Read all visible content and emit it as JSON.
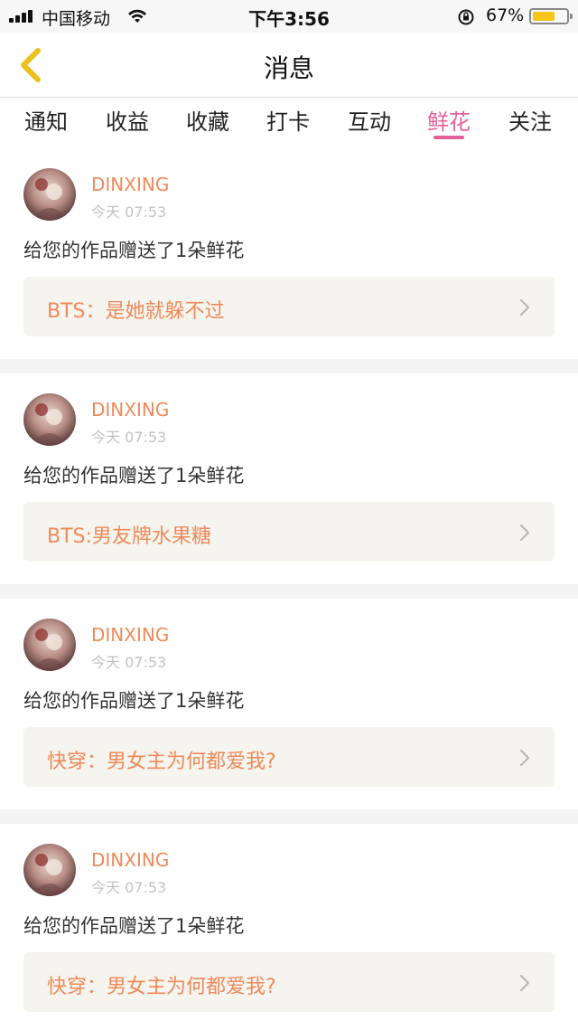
{
  "status_bar": {
    "carrier": "中国移动",
    "time": "下午3:56",
    "battery_percent": "67%",
    "battery_level": 0.67,
    "battery_color": "#f5c518"
  },
  "nav": {
    "title": "消息",
    "back_icon": "chevron-left-icon",
    "back_color": "#e8c21a"
  },
  "tabs": [
    {
      "label": "通知",
      "active": false
    },
    {
      "label": "收益",
      "active": false
    },
    {
      "label": "收藏",
      "active": false
    },
    {
      "label": "打卡",
      "active": false
    },
    {
      "label": "互动",
      "active": false
    },
    {
      "label": "鲜花",
      "active": true
    },
    {
      "label": "关注",
      "active": false
    }
  ],
  "accent_color": "#e2609b",
  "notifications": [
    {
      "user": "DINXING",
      "time": "今天 07:53",
      "message": "给您的作品赠送了1朵鲜花",
      "work": "BTS：是她就躲不过"
    },
    {
      "user": "DINXING",
      "time": "今天 07:53",
      "message": "给您的作品赠送了1朵鲜花",
      "work": "BTS:男友牌水果糖"
    },
    {
      "user": "DINXING",
      "time": "今天 07:53",
      "message": "给您的作品赠送了1朵鲜花",
      "work": "快穿：男女主为何都爱我?"
    },
    {
      "user": "DINXING",
      "time": "今天 07:53",
      "message": "给您的作品赠送了1朵鲜花",
      "work": "快穿：男女主为何都爱我?"
    }
  ]
}
